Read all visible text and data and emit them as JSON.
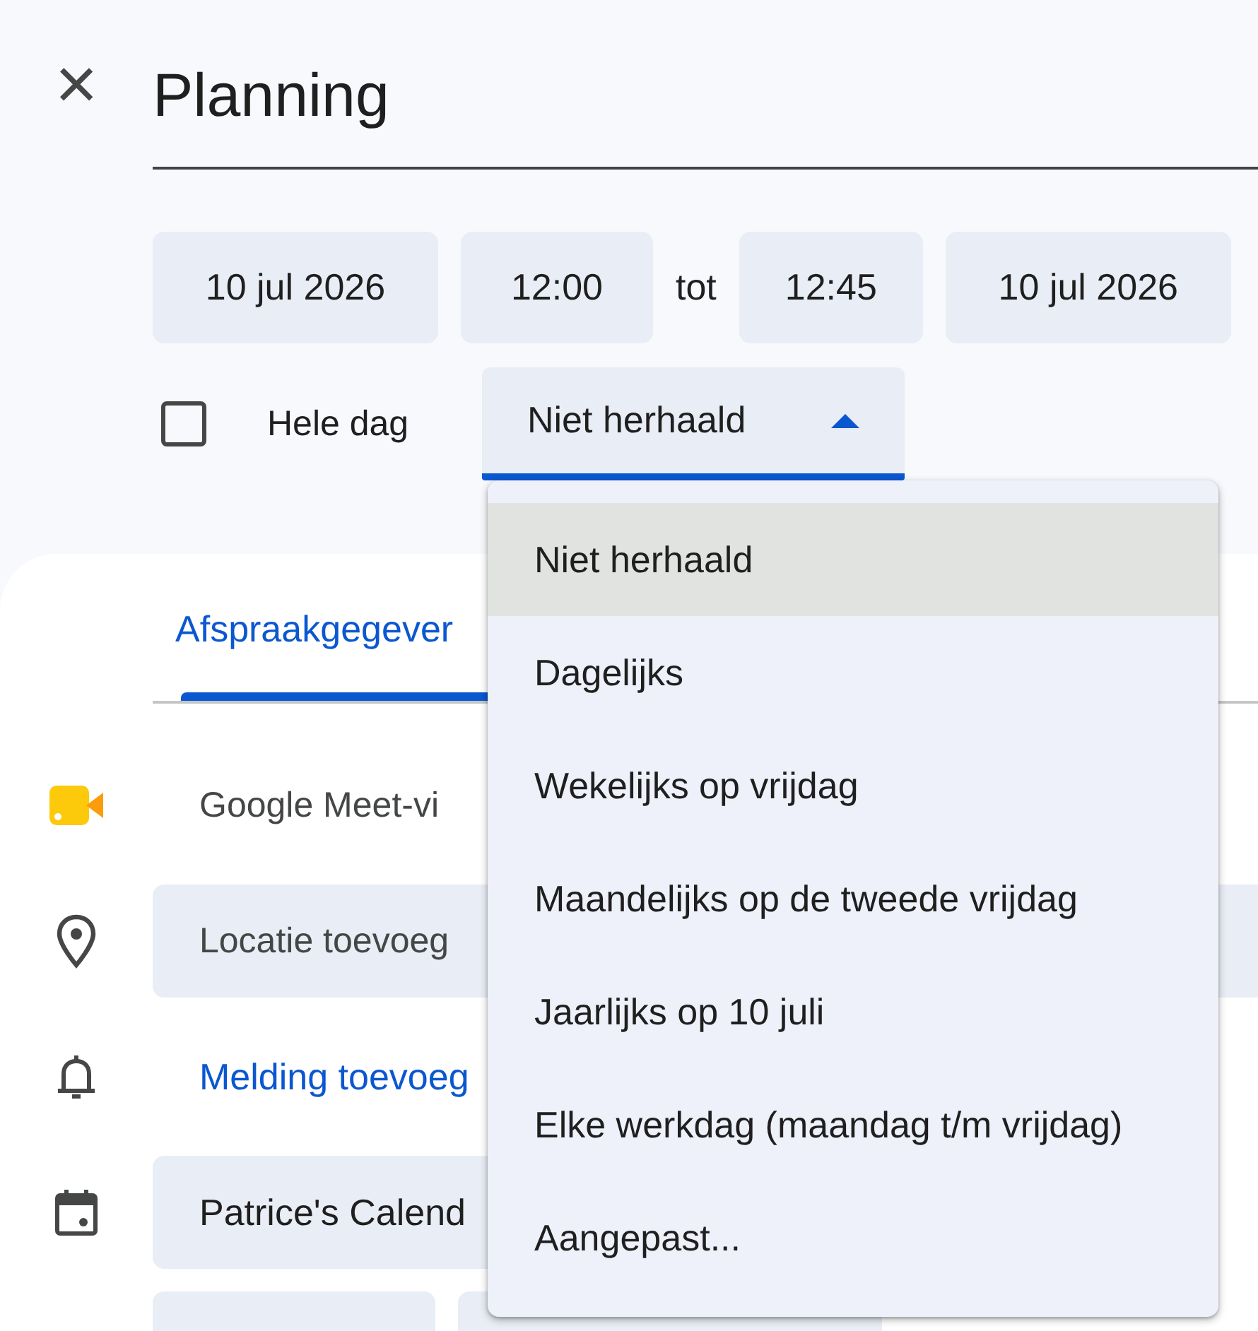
{
  "header": {
    "close": "×",
    "title": "Planning"
  },
  "dates": {
    "start_date": "10 jul 2026",
    "start_time": "12:00",
    "separator": "tot",
    "end_time": "12:45",
    "end_date": "10 jul 2026"
  },
  "all_day": {
    "label": "Hele dag",
    "checked": false
  },
  "repeat": {
    "value": "Niet herhaald",
    "expanded": true
  },
  "tabs": [
    {
      "label": "Afspraakgegever",
      "selected": true
    }
  ],
  "details": [
    {
      "kind": "meet",
      "text": "Google Meet-vi"
    },
    {
      "kind": "location",
      "placeholder": "Locatie toevoeg"
    },
    {
      "kind": "notification",
      "text": "Melding toevoeg"
    },
    {
      "kind": "calendar",
      "value": "Patrice's Calend"
    }
  ],
  "repeat_menu": [
    {
      "label": "Niet herhaald",
      "selected": true
    },
    {
      "label": "Dagelijks",
      "selected": false
    },
    {
      "label": "Wekelijks op vrijdag",
      "selected": false
    },
    {
      "label": "Maandelijks op de tweede vrijdag",
      "selected": false
    },
    {
      "label": "Jaarlijks op 10 juli",
      "selected": false
    },
    {
      "label": "Elke werkdag (maandag t/m vrijdag)",
      "selected": false
    },
    {
      "label": "Aangepast...",
      "selected": false
    }
  ]
}
